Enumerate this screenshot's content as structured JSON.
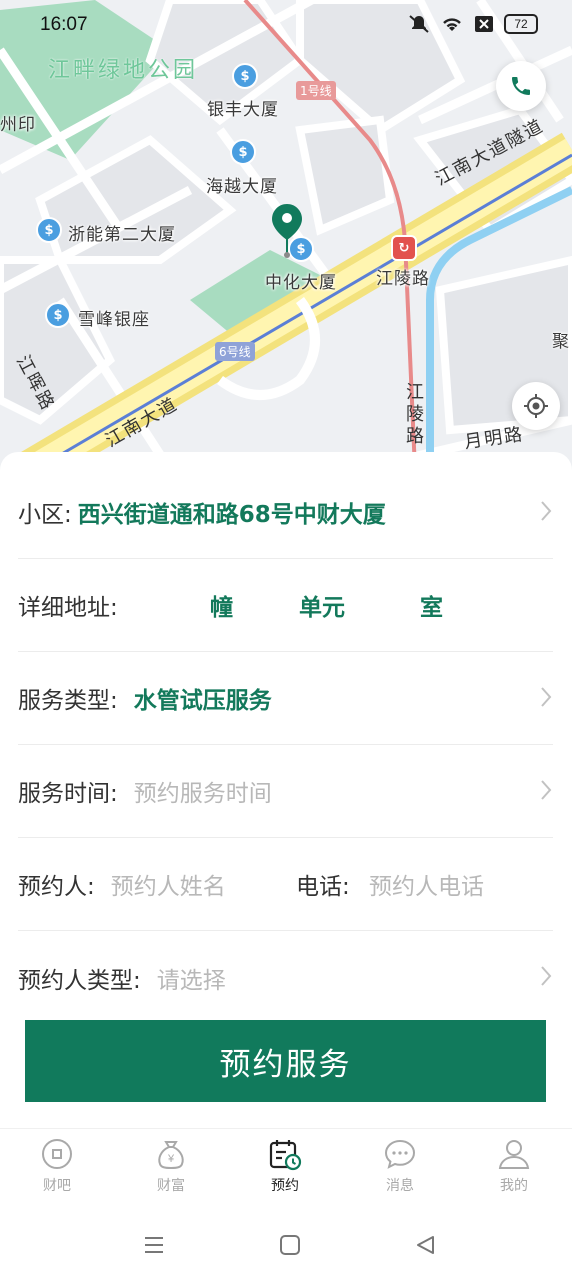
{
  "status_bar": {
    "time": "16:07",
    "battery": "72"
  },
  "map": {
    "park_label": "江畔绿地公园",
    "places": {
      "yinfeng": "银丰大厦",
      "haiyue": "海越大厦",
      "zheneng": "浙能第二大厦",
      "zhonghua": "中化大厦",
      "xuefeng": "雪峰银座",
      "jiangling_stop": "江陵路",
      "zhou": "州印",
      "ju": "聚"
    },
    "roads": {
      "jiangnan_tunnel": "江南大道隧道",
      "jiangnan": "江南大道",
      "jianghui": "江晖路",
      "jiangling": "江陵路",
      "yueming": "月明路"
    },
    "metro": {
      "line1": "1号线",
      "line6": "6号线"
    }
  },
  "form": {
    "community": {
      "label": "小区:",
      "value": "西兴街道通和路68号中财大厦"
    },
    "address": {
      "label": "详细地址:",
      "building": "幢",
      "unit": "单元",
      "room": "室"
    },
    "service_type": {
      "label": "服务类型:",
      "value": "水管试压服务"
    },
    "service_time": {
      "label": "服务时间:",
      "placeholder": "预约服务时间"
    },
    "booker": {
      "label": "预约人:",
      "placeholder": "预约人姓名",
      "phone_label": "电话:",
      "phone_placeholder": "预约人电话"
    },
    "booker_type": {
      "label": "预约人类型:",
      "placeholder": "请选择"
    },
    "submit_label": "预约服务"
  },
  "tabs": [
    {
      "label": "财吧",
      "icon": "circle-square-icon"
    },
    {
      "label": "财富",
      "icon": "money-bag-icon"
    },
    {
      "label": "预约",
      "icon": "calendar-clock-icon"
    },
    {
      "label": "消息",
      "icon": "chat-bubble-icon"
    },
    {
      "label": "我的",
      "icon": "user-icon"
    }
  ],
  "colors": {
    "accent": "#117a5c",
    "accent_text": "#13795b",
    "placeholder": "#b8b8b8"
  }
}
